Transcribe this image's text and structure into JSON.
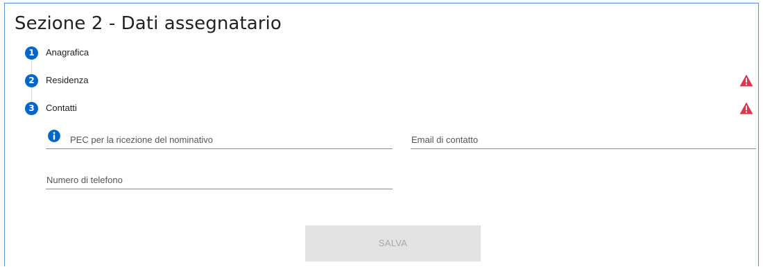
{
  "section": {
    "title": "Sezione 2 - Dati assegnatario"
  },
  "steps": [
    {
      "number": "1",
      "label": "Anagrafica",
      "warning": false
    },
    {
      "number": "2",
      "label": "Residenza",
      "warning": true
    },
    {
      "number": "3",
      "label": "Contatti",
      "warning": true
    }
  ],
  "form": {
    "pec_label": "PEC per la ricezione del nominativo",
    "email_label": "Email di contatto",
    "phone_label": "Numero di telefono",
    "pec_value": "",
    "email_value": "",
    "phone_value": ""
  },
  "actions": {
    "save_label": "SALVA"
  },
  "icons": {
    "step_badge": "step-number-icon",
    "warning": "warning-triangle-icon",
    "info": "info-icon"
  },
  "colors": {
    "primary": "#0066cc",
    "warning": "#d9364f",
    "border": "#5b8bd6",
    "button_disabled_bg": "#e3e3e3",
    "button_disabled_text": "#a8a8a8"
  }
}
